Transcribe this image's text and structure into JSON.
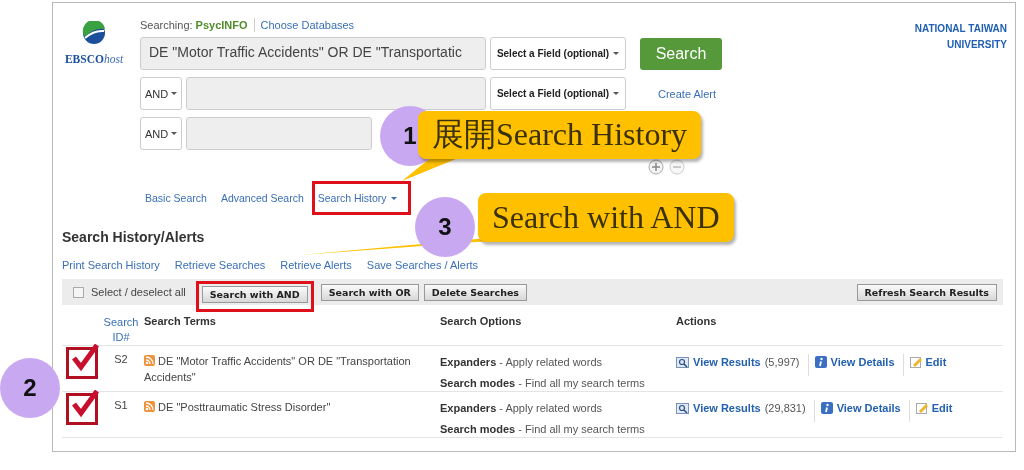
{
  "logo": {
    "brand": "EBSCO",
    "suffix": "host"
  },
  "searching": {
    "label": "Searching:",
    "database": "PsycINFO",
    "link": "Choose Databases"
  },
  "institution": "NATIONAL TAIWAN UNIVERSITY",
  "search_rows": [
    {
      "value": "DE \"Motor Traffic Accidents\" OR DE \"Transportatic",
      "field": "Select a Field (optional)"
    },
    {
      "operator": "AND",
      "field": "Select a Field (optional)"
    },
    {
      "operator": "AND"
    }
  ],
  "search_button": "Search",
  "create_alert": "Create Alert",
  "nav_links": [
    {
      "label": "Basic Search",
      "dropdown": false,
      "highlighted": false
    },
    {
      "label": "Advanced Search",
      "dropdown": false,
      "highlighted": false
    },
    {
      "label": "Search History",
      "dropdown": true,
      "highlighted": true
    }
  ],
  "history": {
    "title": "Search History/Alerts",
    "links": [
      "Print Search History",
      "Retrieve Searches",
      "Retrieve Alerts",
      "Save Searches / Alerts"
    ],
    "select_all": {
      "label": "Select / deselect all",
      "checked": false
    },
    "buttons": [
      {
        "label": "Search with AND",
        "highlighted": true
      },
      {
        "label": "Search with OR",
        "highlighted": false
      },
      {
        "label": "Delete Searches",
        "highlighted": false
      }
    ],
    "refresh_button": "Refresh Search Results",
    "columns": [
      "Search ID#",
      "Search Terms",
      "Search Options",
      "Actions"
    ],
    "rows": [
      {
        "checked": true,
        "id": "S2",
        "terms": "DE \"Motor Traffic Accidents\" OR DE \"Transportation Accidents\"",
        "options": [
          "**Expanders** - Apply related words",
          "**Search modes** - Find all my search terms"
        ],
        "view_results": "View Results",
        "count": "(5,997)",
        "view_details": "View Details",
        "edit": "Edit"
      },
      {
        "checked": true,
        "id": "S1",
        "terms": "DE \"Posttraumatic Stress Disorder\"",
        "options": [
          "**Expanders** - Apply related words",
          "**Search modes** - Find all my search terms"
        ],
        "view_results": "View Results",
        "count": "(29,831)",
        "view_details": "View Details",
        "edit": "Edit"
      }
    ]
  },
  "annotations": [
    {
      "number": "1",
      "text": "展開Search History"
    },
    {
      "number": "3",
      "text": "Search with AND"
    },
    {
      "number": "2"
    }
  ]
}
